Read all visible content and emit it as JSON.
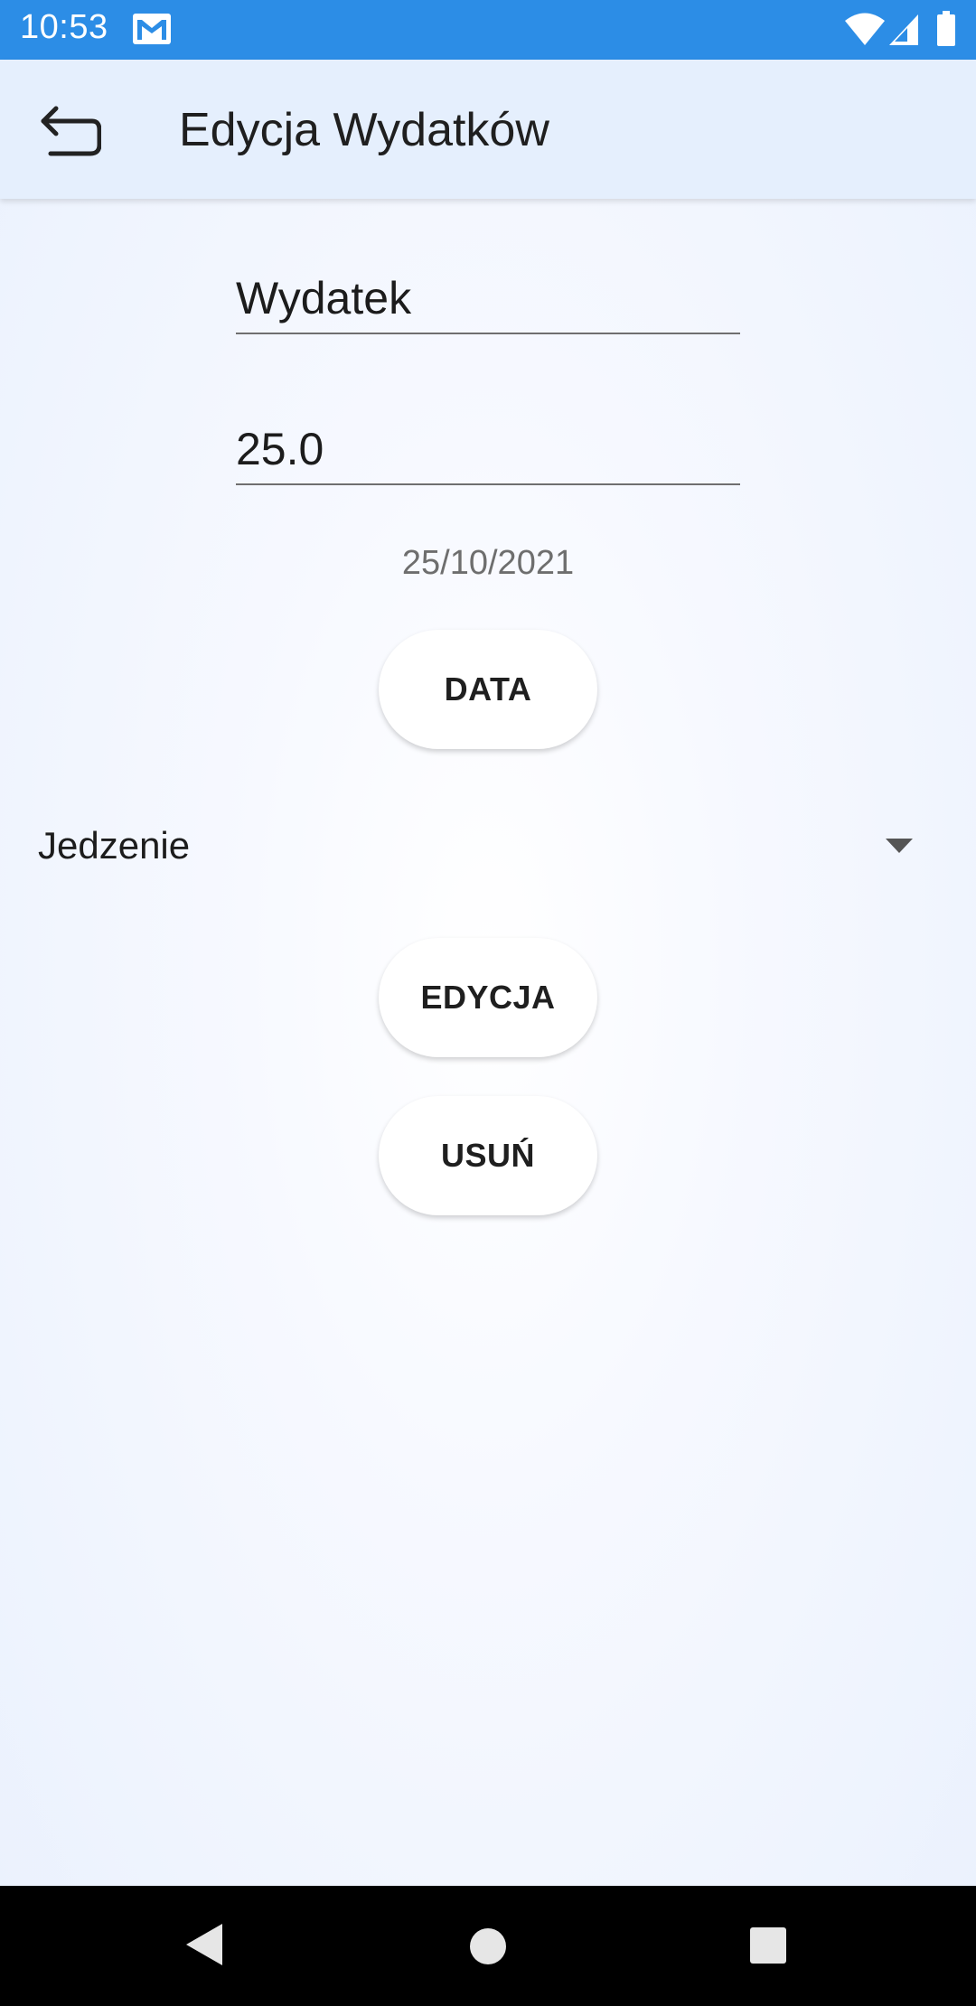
{
  "status_bar": {
    "time": "10:53",
    "icons": [
      "gmail-icon",
      "wifi-icon",
      "signal-icon",
      "battery-icon"
    ],
    "color": "#2c8de6"
  },
  "app_bar": {
    "title": "Edycja Wydatków",
    "back_icon": "undo-arrow-icon",
    "color": "#e5effd"
  },
  "form": {
    "name_value": "Wydatek",
    "amount_value": "25.0",
    "date_text": "25/10/2021",
    "date_button_label": "DATA",
    "category_selected": "Jedzenie",
    "edit_button_label": "EDYCJA",
    "delete_button_label": "USUŃ"
  },
  "nav_bar": {
    "icons": [
      "back-triangle-icon",
      "home-circle-icon",
      "recents-square-icon"
    ]
  }
}
